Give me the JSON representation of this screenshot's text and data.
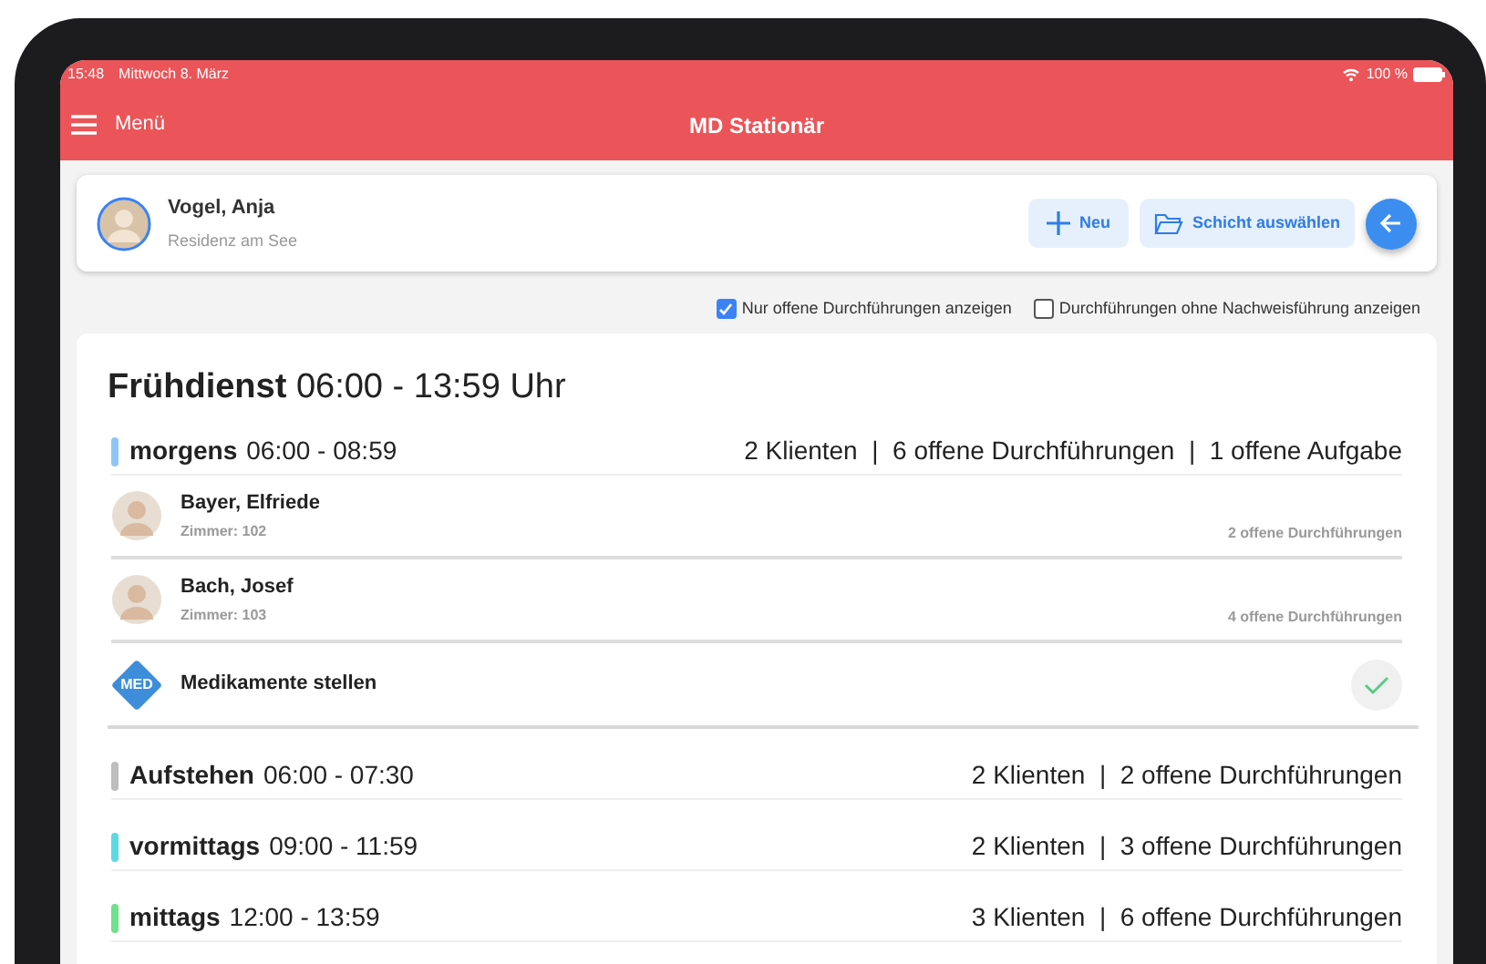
{
  "status_bar": {
    "time": "15:48",
    "date": "Mittwoch 8. März",
    "battery": "100 %"
  },
  "nav_bar": {
    "menu_label": "Menü",
    "title": "MD Stationär"
  },
  "user": {
    "name": "Vogel, Anja",
    "facility": "Residenz am See"
  },
  "buttons": [
    {
      "kind": "new",
      "label": "Neu"
    },
    {
      "kind": "shift",
      "label": "Schicht auswählen"
    },
    {
      "kind": "back"
    }
  ],
  "filters": [
    {
      "label": "Nur offene Durchführungen anzeigen",
      "checked": true
    },
    {
      "label": "Durchführungen ohne Nachweisführung anzeigen",
      "checked": false
    }
  ],
  "shift": {
    "name": "Frühdienst",
    "time": "06:00 - 13:59 Uhr"
  },
  "periods": [
    {
      "name": "morgens",
      "time": "06:00 - 08:59",
      "summary": "2 Klienten  |  6 offene Durchführungen  |  1 offene Aufgabe",
      "color": "#8ec5f7",
      "clients": [
        {
          "name": "Bayer, Elfriede",
          "room": "Zimmer: 102",
          "open": "2 offene Durchführungen"
        },
        {
          "name": "Bach, Josef",
          "room": "Zimmer: 103",
          "open": "4 offene Durchführungen"
        }
      ],
      "tasks": [
        {
          "badge": "MED",
          "label": "Medikamente stellen"
        }
      ]
    },
    {
      "name": "Aufstehen",
      "time": "06:00 - 07:30",
      "summary": "2 Klienten  |  2 offene Durchführungen",
      "color": "#bdbdbd"
    },
    {
      "name": "vormittags",
      "time": "09:00 - 11:59",
      "summary": "2 Klienten  |  3 offene Durchführungen",
      "color": "#5dd9e3"
    },
    {
      "name": "mittags",
      "time": "12:00 - 13:59",
      "summary": "3 Klienten  |  6 offene Durchführungen",
      "color": "#6fe08e"
    }
  ]
}
